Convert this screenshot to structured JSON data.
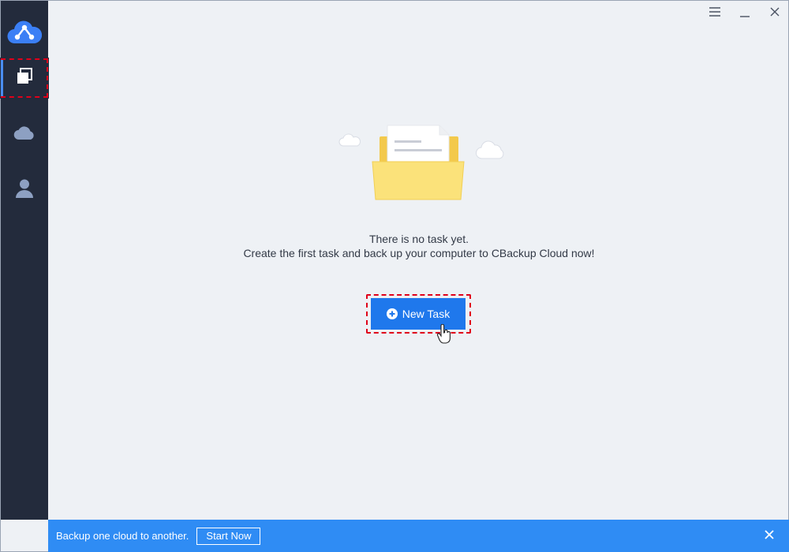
{
  "window": {
    "controls": {
      "menu_icon": "hamburger-menu-icon",
      "minimize_icon": "minimize-icon",
      "close_icon": "close-icon"
    }
  },
  "sidebar": {
    "logo_icon": "cbackup-logo-icon",
    "items": [
      {
        "id": "tasks",
        "icon": "tasks-icon",
        "selected": true
      },
      {
        "id": "cloud",
        "icon": "cloud-icon",
        "selected": false
      },
      {
        "id": "account",
        "icon": "user-icon",
        "selected": false
      }
    ]
  },
  "main": {
    "empty_state": {
      "illustration": "folder-with-document-illustration",
      "line1": "There is no task yet.",
      "line2": "Create the first task and back up your computer to CBackup Cloud now!"
    },
    "new_task_button": {
      "label": "New Task",
      "icon": "plus-circle-icon"
    }
  },
  "banner": {
    "text": "Backup one cloud to another.",
    "button_label": "Start Now",
    "close_icon": "close-icon"
  },
  "colors": {
    "sidebar_bg": "#232b3c",
    "content_bg": "#eef1f5",
    "primary_button": "#1f78ec",
    "banner_bg": "#2f8cf4",
    "highlight_dashes": "#e0001a",
    "folder_yellow": "#fbe27a"
  }
}
